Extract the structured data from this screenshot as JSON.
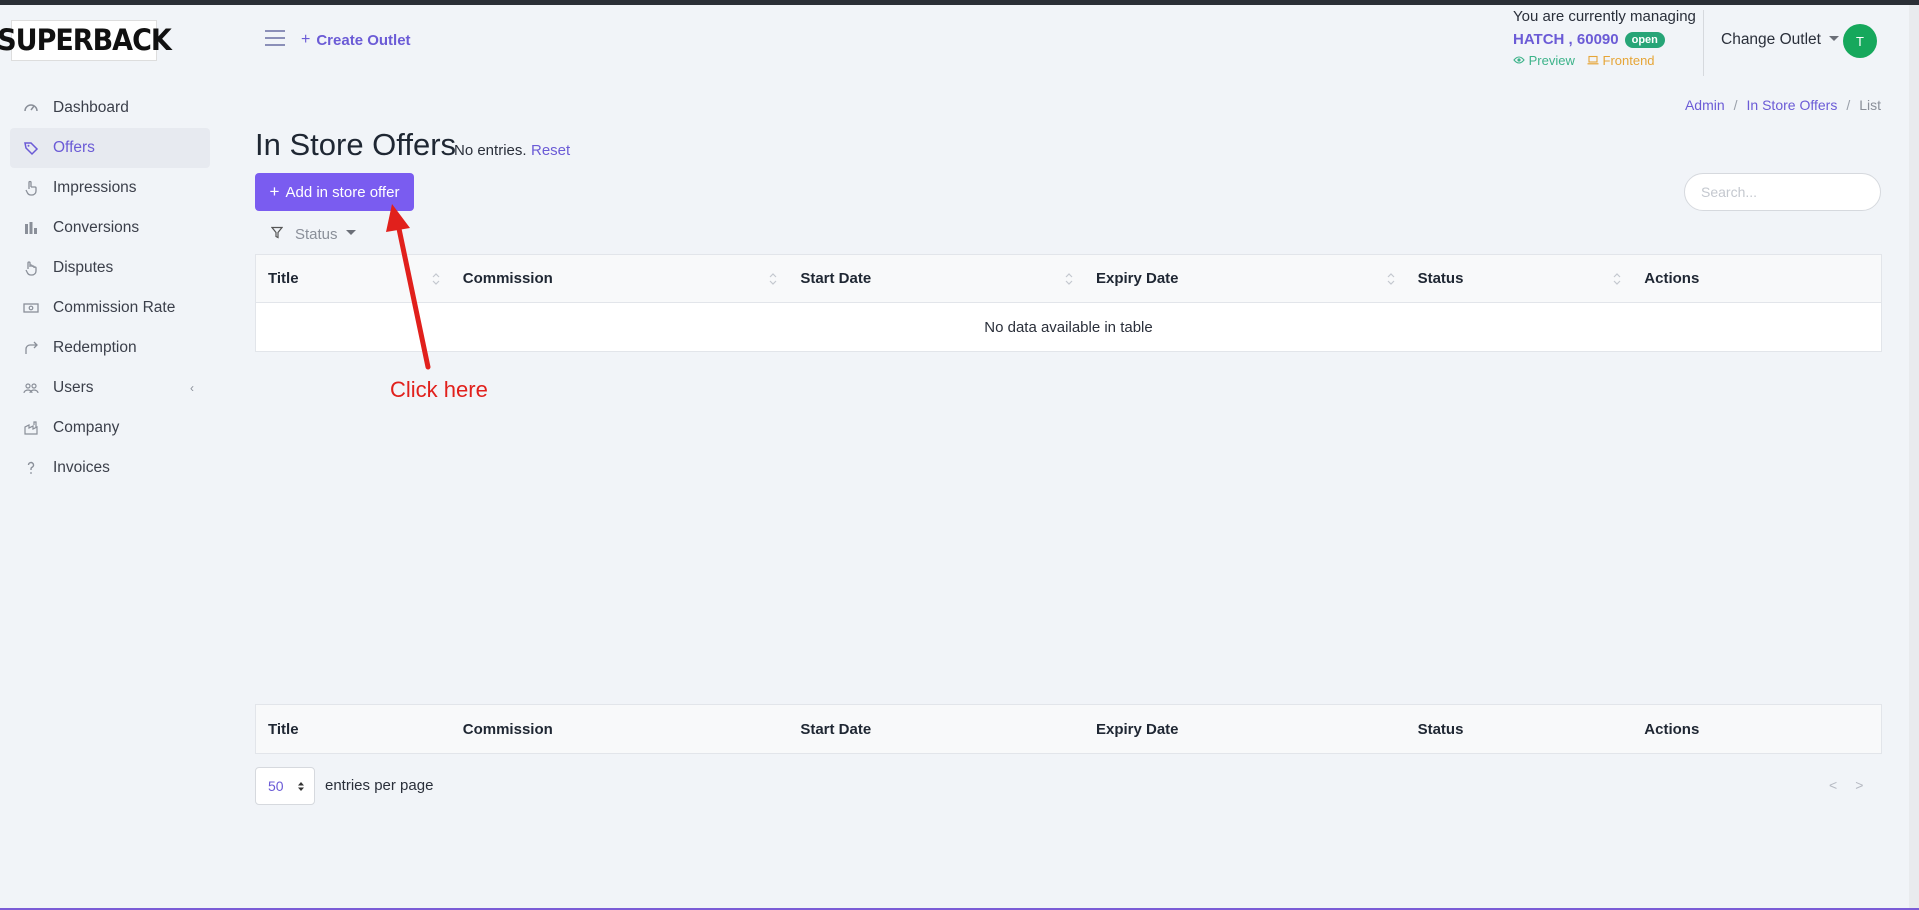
{
  "brand": {
    "logo_text": "SUPERBACK"
  },
  "sidebar": {
    "items": [
      {
        "label": "Dashboard",
        "icon": "dashboard-icon"
      },
      {
        "label": "Offers",
        "icon": "tag-icon",
        "active": true
      },
      {
        "label": "Impressions",
        "icon": "pointer-hand-icon"
      },
      {
        "label": "Conversions",
        "icon": "bar-chart-icon"
      },
      {
        "label": "Disputes",
        "icon": "hand-icon"
      },
      {
        "label": "Commission Rate",
        "icon": "money-icon"
      },
      {
        "label": "Redemption",
        "icon": "share-arrow-icon"
      },
      {
        "label": "Users",
        "icon": "users-icon",
        "has_submenu": true
      },
      {
        "label": "Company",
        "icon": "factory-icon"
      },
      {
        "label": "Invoices",
        "icon": "question-icon"
      }
    ]
  },
  "header": {
    "create_outlet": "Create Outlet",
    "managing_label": "You are currently managing",
    "outlet_name": "HATCH , 60090",
    "outlet_status": "open",
    "preview_label": "Preview",
    "frontend_label": "Frontend",
    "change_outlet": "Change Outlet",
    "avatar_initial": "T"
  },
  "breadcrumb": {
    "admin": "Admin",
    "section": "In Store Offers",
    "current": "List"
  },
  "page": {
    "title": "In Store Offers",
    "entries_note": "No entries.",
    "reset": "Reset",
    "add_button": "Add in store offer",
    "search_placeholder": "Search...",
    "status_filter": "Status"
  },
  "table": {
    "columns": [
      "Title",
      "Commission",
      "Start Date",
      "Expiry Date",
      "Status",
      "Actions"
    ],
    "empty_message": "No data available in table"
  },
  "pagination": {
    "per_page": "50",
    "per_page_label": "entries per page",
    "prev": "<",
    "next": ">"
  },
  "annotation": {
    "text": "Click here",
    "color": "#e1201c"
  },
  "colors": {
    "accent": "#7a5cf0",
    "link": "#6b5bd6",
    "success": "#27a577",
    "warning": "#e6a537",
    "avatar": "#16a85c"
  }
}
